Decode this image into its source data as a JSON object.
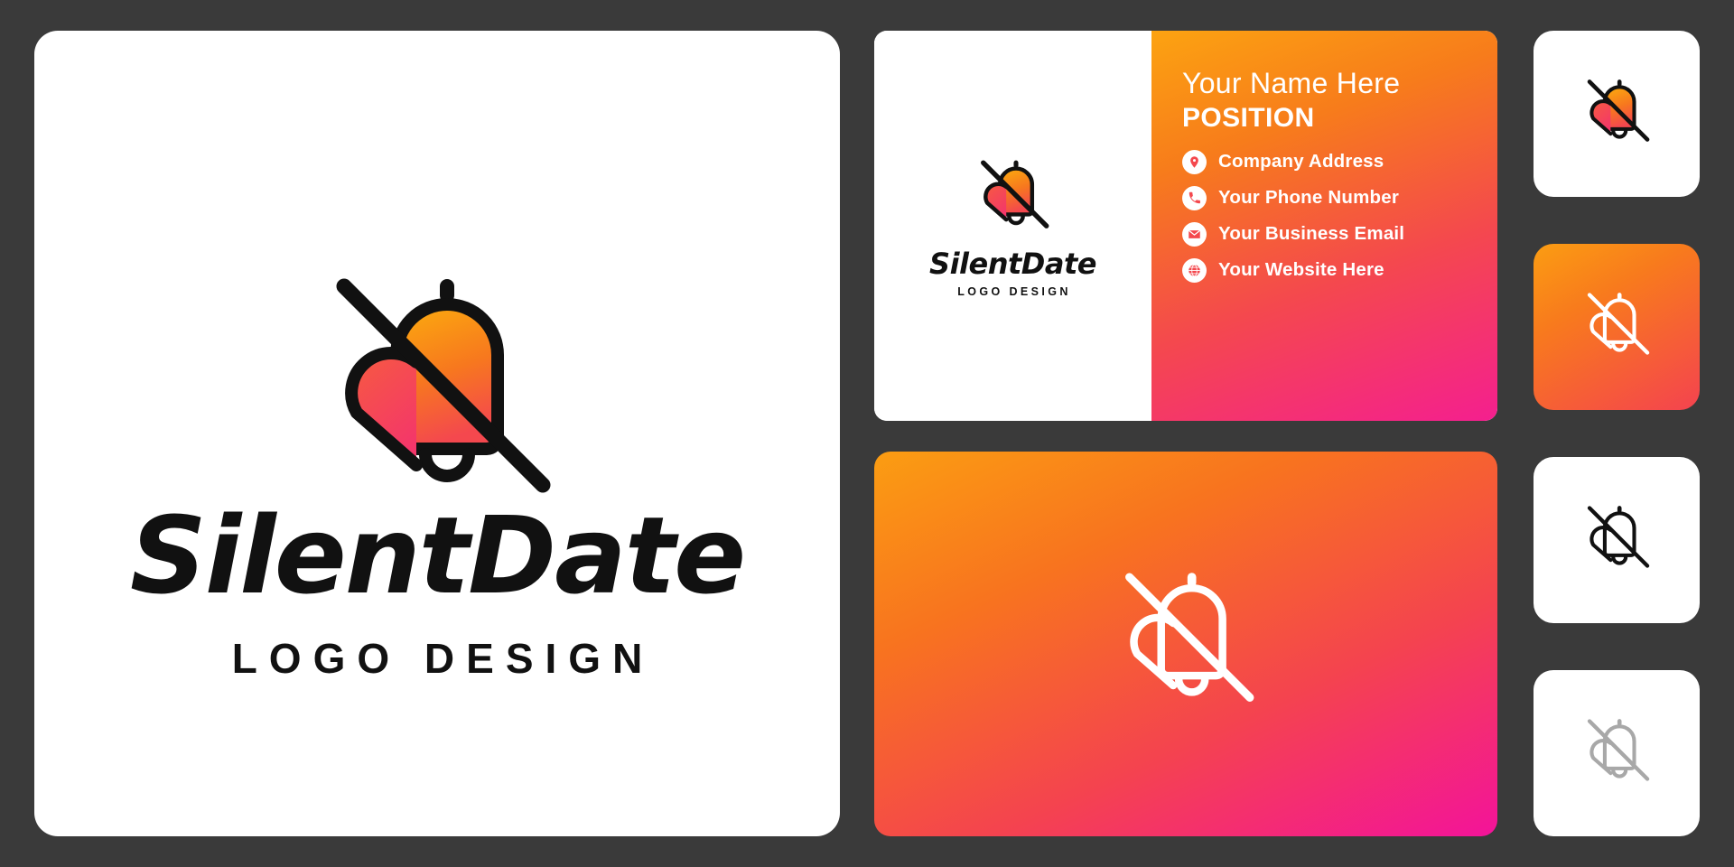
{
  "brand": {
    "name": "SilentDate",
    "tagline": "LOGO DESIGN",
    "mark_name": "silent-bell-logo",
    "colors": {
      "orange": "#fca311",
      "red": "#f4484e",
      "pink": "#f41f8f",
      "ink": "#111111",
      "background": "#3a3a3a",
      "panel": "#ffffff",
      "grey_mark": "#a8a8a8"
    }
  },
  "main_panel": {
    "wordmark": "SilentDate",
    "subtitle": "LOGO DESIGN"
  },
  "business_card": {
    "name_line": "Your Name Here",
    "position_line": "POSITION",
    "contacts": [
      {
        "icon": "location-pin-icon",
        "label": "Company Address"
      },
      {
        "icon": "phone-icon",
        "label": "Your Phone Number"
      },
      {
        "icon": "envelope-icon",
        "label": "Your Business Email"
      },
      {
        "icon": "globe-icon",
        "label": "Your Website Here"
      }
    ],
    "logo_wordmark": "SilentDate",
    "logo_subtitle": "LOGO DESIGN"
  },
  "gradient_panel": {
    "mark_name": "silent-bell-outline-white"
  },
  "icon_tiles": [
    {
      "name": "icon-tile-white-color-mark",
      "style": "white-background",
      "mark": "silent-bell-color"
    },
    {
      "name": "icon-tile-gradient-white-mark",
      "style": "gradient-background",
      "mark": "silent-bell-outline-white"
    },
    {
      "name": "icon-tile-white-black-mark",
      "style": "white-background",
      "mark": "silent-bell-outline-black"
    },
    {
      "name": "icon-tile-white-grey-mark",
      "style": "white-background",
      "mark": "silent-bell-outline-grey"
    }
  ]
}
